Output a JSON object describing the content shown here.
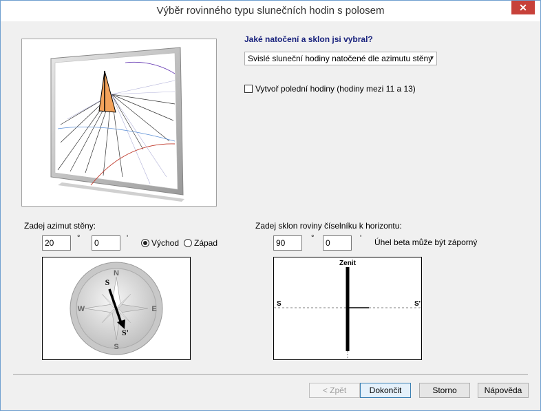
{
  "window": {
    "title": "Výběr rovinného typu slunečních hodin s polosem",
    "close_glyph": "✕"
  },
  "question": "Jaké natočení a sklon jsi vybral?",
  "type_select": {
    "value": "Svislé sluneční hodiny natočené dle azimutu stěny",
    "arrow": "▾"
  },
  "noon_checkbox": {
    "label": "Vytvoř polední hodiny (hodiny mezi 11 a 13)",
    "checked": false
  },
  "azimuth": {
    "label": "Zadej azimut stěny:",
    "degrees": "20",
    "minutes": "0",
    "deg_unit": "°",
    "min_unit": "'",
    "east_label": "Východ",
    "west_label": "Západ",
    "selected": "Východ"
  },
  "compass": {
    "north": "N",
    "south": "S",
    "east": "E",
    "west": "W",
    "marker_s": "S",
    "marker_s_prime": "S'"
  },
  "tilt": {
    "label": "Zadej sklon roviny číselníku k horizontu:",
    "degrees": "90",
    "minutes": "0",
    "deg_unit": "°",
    "min_unit": "'",
    "note": "Úhel beta může být záporný"
  },
  "tilt_diagram": {
    "top_label": "Zenit",
    "left_label": "S",
    "right_label": "S'"
  },
  "buttons": {
    "back": "< Zpět",
    "finish": "Dokončit",
    "cancel": "Storno",
    "help": "Nápověda"
  }
}
